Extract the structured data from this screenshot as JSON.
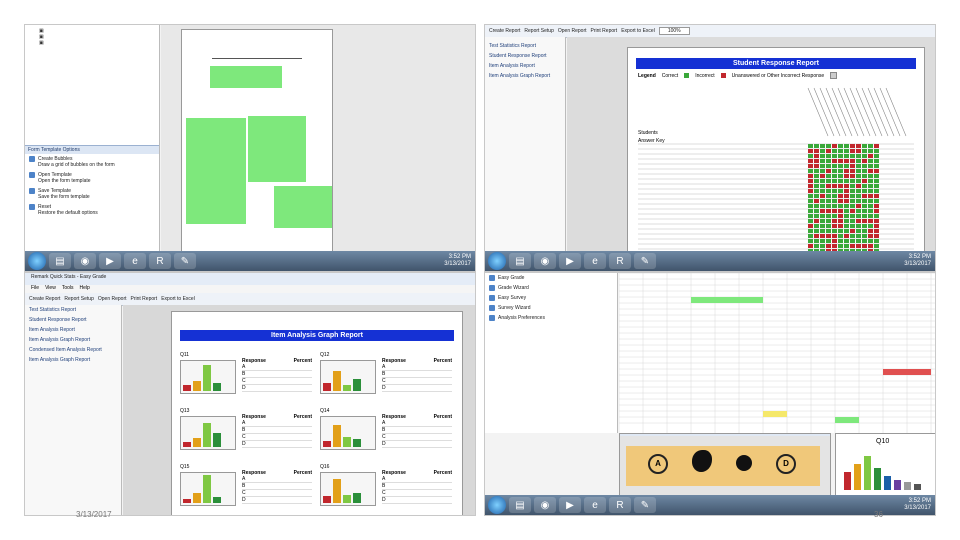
{
  "footer": {
    "date": "3/13/2017",
    "page_number": "36"
  },
  "taskbar": {
    "time": "3:52 PM",
    "date": "3/13/2017"
  },
  "top_left": {
    "tree_items": [
      "",
      "",
      ""
    ],
    "pane_title": "Form Template Options",
    "options": [
      {
        "title": "Create Bubbles",
        "desc": "Draw a grid of bubbles on the form"
      },
      {
        "title": "Open Template",
        "desc": "Open the form template"
      },
      {
        "title": "Save Template",
        "desc": "Save the form template"
      },
      {
        "title": "Reset",
        "desc": "Restore the default options"
      }
    ]
  },
  "top_right": {
    "toolbar": [
      "Create Report",
      "Report Setup",
      "Open Report",
      "Print Report",
      "Export to Excel"
    ],
    "zoom": "100%",
    "report_title": "Student Response Report",
    "legend_label": "Legend",
    "legend_correct": "Correct",
    "legend_incorrect": "Incorrect",
    "legend_other": "Unanswered or Other Incorrect Response",
    "col_students": "Students",
    "col_answer_key": "Answer Key",
    "sidebar": [
      {
        "t": "",
        "d": ""
      },
      {
        "t": "Test Statistics Report",
        "d": ""
      },
      {
        "t": "Student Response Report",
        "d": ""
      },
      {
        "t": "Item Analysis Report",
        "d": ""
      },
      {
        "t": "Item Analysis Graph Report",
        "d": ""
      },
      {
        "t": "",
        "d": ""
      }
    ]
  },
  "bottom_left": {
    "window_title": "Remark Quick Stats - Easy Grade",
    "menu": [
      "File",
      "View",
      "Tools",
      "Help"
    ],
    "toolbar": [
      "Create Report",
      "Report Setup",
      "Open Report",
      "Print Report",
      "Export to Excel"
    ],
    "report_title": "Item Analysis Graph Report",
    "question_labels": [
      "Q11",
      "Q12",
      "Q13",
      "Q14",
      "Q15",
      "Q16"
    ],
    "col_response": "Response",
    "col_percent": "Percent",
    "responses": [
      "A",
      "B",
      "C",
      "D"
    ],
    "sidebar": [
      {
        "t": "Test Statistics Report",
        "d": ""
      },
      {
        "t": "Student Response Report",
        "d": ""
      },
      {
        "t": "Item Analysis Report",
        "d": ""
      },
      {
        "t": "Item Analysis Graph Report",
        "d": ""
      },
      {
        "t": "Condensed Item Analysis Report",
        "d": ""
      },
      {
        "t": "Item Analysis Graph Report",
        "d": ""
      }
    ]
  },
  "bottom_right": {
    "wizard_items": [
      {
        "t": "Easy Grade",
        "d": ""
      },
      {
        "t": "Grade Wizard",
        "d": ""
      },
      {
        "t": "Easy Survey",
        "d": ""
      },
      {
        "t": "Survey Wizard",
        "d": ""
      },
      {
        "t": "Analysis Preferences",
        "d": ""
      }
    ],
    "image_caption": "",
    "chart_label": "Q10",
    "bubble_labels": [
      "A",
      "D"
    ]
  },
  "colors": {
    "green": "#7ee87c",
    "red": "#c1272d",
    "blue": "#1531d4"
  }
}
